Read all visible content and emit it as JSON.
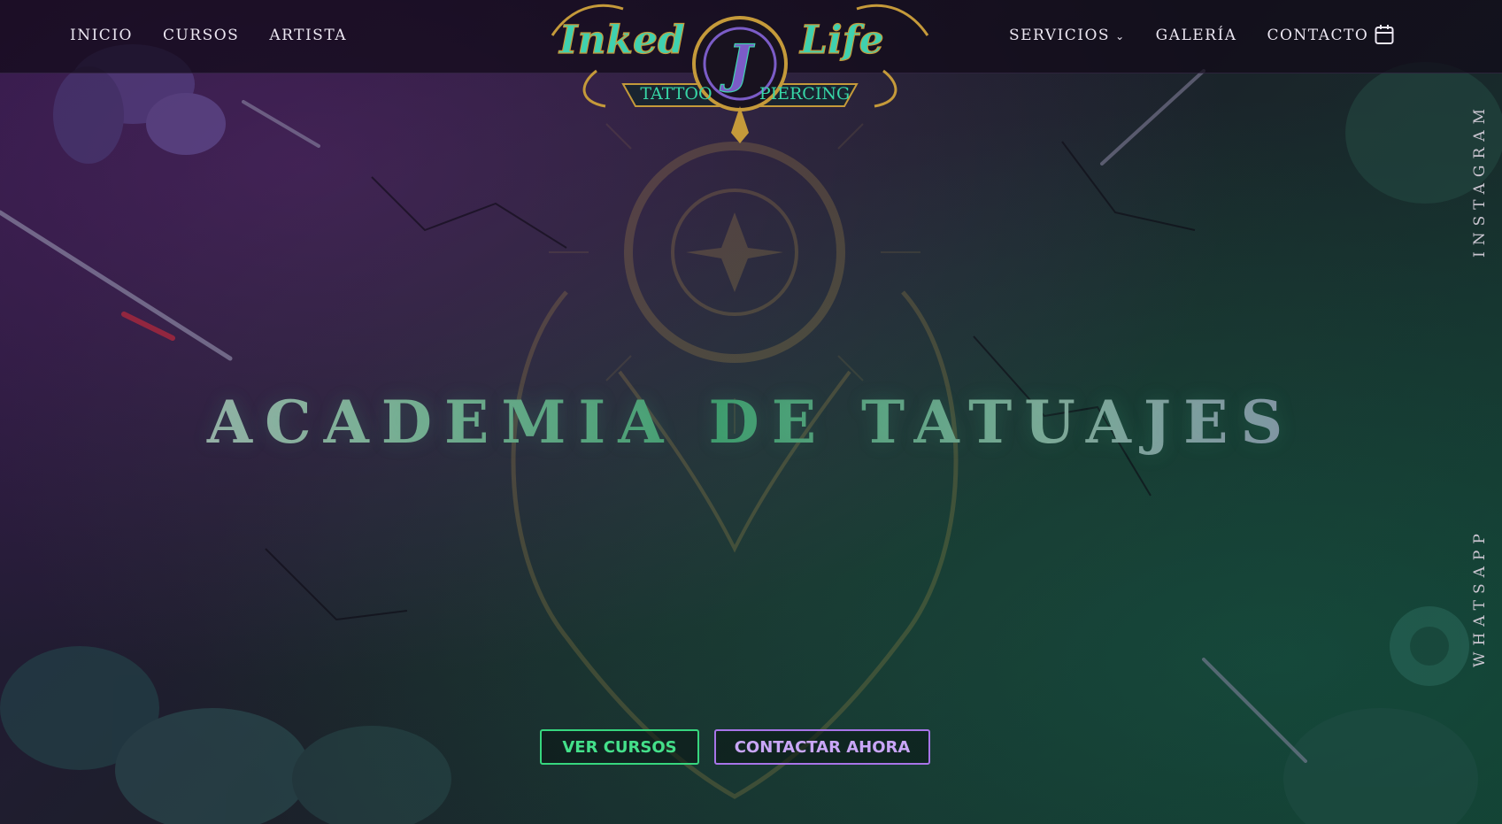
{
  "nav": {
    "left": [
      {
        "label": "INICIO"
      },
      {
        "label": "CURSOS"
      },
      {
        "label": "ARTISTA"
      }
    ],
    "right": [
      {
        "label": "SERVICIOS"
      },
      {
        "label": "GALERÍA"
      },
      {
        "label": "CONTACTO"
      }
    ],
    "services_icon": "chevron-down-icon",
    "calendar_icon": "calendar-icon"
  },
  "logo": {
    "word_left": "Inked",
    "word_right": "Life",
    "left_sub": "TATTOO",
    "right_sub": "PIERCING",
    "colors": {
      "teal": "#3fd1b0",
      "gold": "#c59a3a",
      "purple": "#7b5cc7"
    }
  },
  "hero": {
    "title": "ACADEMIA DE TATUAJES",
    "buttons": {
      "primary": "VER CURSOS",
      "secondary": "CONTACTAR AHORA"
    },
    "colors": {
      "green": "#37d67e",
      "purple": "#a774e8"
    }
  },
  "side_links": {
    "instagram": "INSTAGRAM",
    "whatsapp": "WHATSAPP"
  }
}
